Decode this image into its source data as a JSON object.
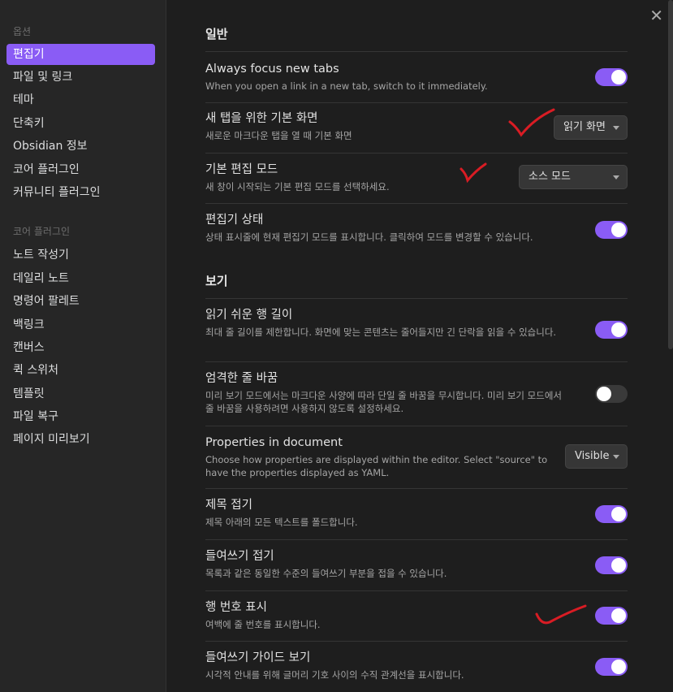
{
  "sidebar": {
    "heading_options": "옵션",
    "options": [
      {
        "label": "편집기"
      },
      {
        "label": "파일 및 링크"
      },
      {
        "label": "테마"
      },
      {
        "label": "단축키"
      },
      {
        "label": "Obsidian 정보"
      },
      {
        "label": "코어 플러그인"
      },
      {
        "label": "커뮤니티 플러그인"
      }
    ],
    "heading_core": "코어 플러그인",
    "core_plugins": [
      {
        "label": "노트 작성기"
      },
      {
        "label": "데일리 노트"
      },
      {
        "label": "명령어 팔레트"
      },
      {
        "label": "백링크"
      },
      {
        "label": "캔버스"
      },
      {
        "label": "퀵 스위처"
      },
      {
        "label": "템플릿"
      },
      {
        "label": "파일 복구"
      },
      {
        "label": "페이지 미리보기"
      }
    ]
  },
  "main": {
    "close_glyph": "✕",
    "section_general": "일반",
    "section_view": "보기",
    "settings": [
      {
        "title": "Always focus new tabs",
        "desc": "When you open a link in a new tab, switch to it immediately.",
        "control": "toggle",
        "on": true
      },
      {
        "title": "새 탭을 위한 기본 화면",
        "desc": "새로운 마크다운 탭을 열 때 기본 화면",
        "control": "dropdown",
        "value": "읽기 화면"
      },
      {
        "title": "기본 편집 모드",
        "desc": "새 창이 시작되는 기본 편집 모드를 선택하세요.",
        "control": "dropdown",
        "value": "소스 모드"
      },
      {
        "title": "편집기 상태",
        "desc": "상태 표시줄에 현재 편집기 모드를 표시합니다. 클릭하여 모드를 변경할 수 있습니다.",
        "control": "toggle",
        "on": true
      },
      {
        "title": "읽기 쉬운 행 길이",
        "desc": "최대 줄 길이를 제한합니다. 화면에 맞는 콘텐츠는 줄어들지만 긴 단락을 읽을 수 있습니다.",
        "control": "toggle",
        "on": true
      },
      {
        "title": "엄격한 줄 바꿈",
        "desc": "미리 보기 모드에서는 마크다운 사양에 따라 단일 줄 바꿈을 무시합니다. 미리 보기 모드에서 줄 바꿈을 사용하려면 사용하지 않도록 설정하세요.",
        "control": "toggle",
        "on": false
      },
      {
        "title": "Properties in document",
        "desc": "Choose how properties are displayed within the editor. Select \"source\" to have the properties displayed as YAML.",
        "control": "dropdown",
        "value": "Visible"
      },
      {
        "title": "제목 접기",
        "desc": "제목 아래의 모든 텍스트를 폴드합니다.",
        "control": "toggle",
        "on": true
      },
      {
        "title": "들여쓰기 접기",
        "desc": "목록과 같은 동일한 수준의 들여쓰기 부분을 접을 수 있습니다.",
        "control": "toggle",
        "on": true
      },
      {
        "title": "행 번호 표시",
        "desc": "여백에 줄 번호를 표시합니다.",
        "control": "toggle",
        "on": true
      },
      {
        "title": "들여쓰기 가이드 보기",
        "desc": "시각적 안내를 위해 글머리 기호 사이의 수직 관계선을 표시합니다.",
        "control": "toggle",
        "on": true
      }
    ]
  },
  "colors": {
    "accent": "#8a5cf5",
    "annotation": "#d91c24",
    "background": "#1e1e1e",
    "sidebar": "#262626"
  }
}
